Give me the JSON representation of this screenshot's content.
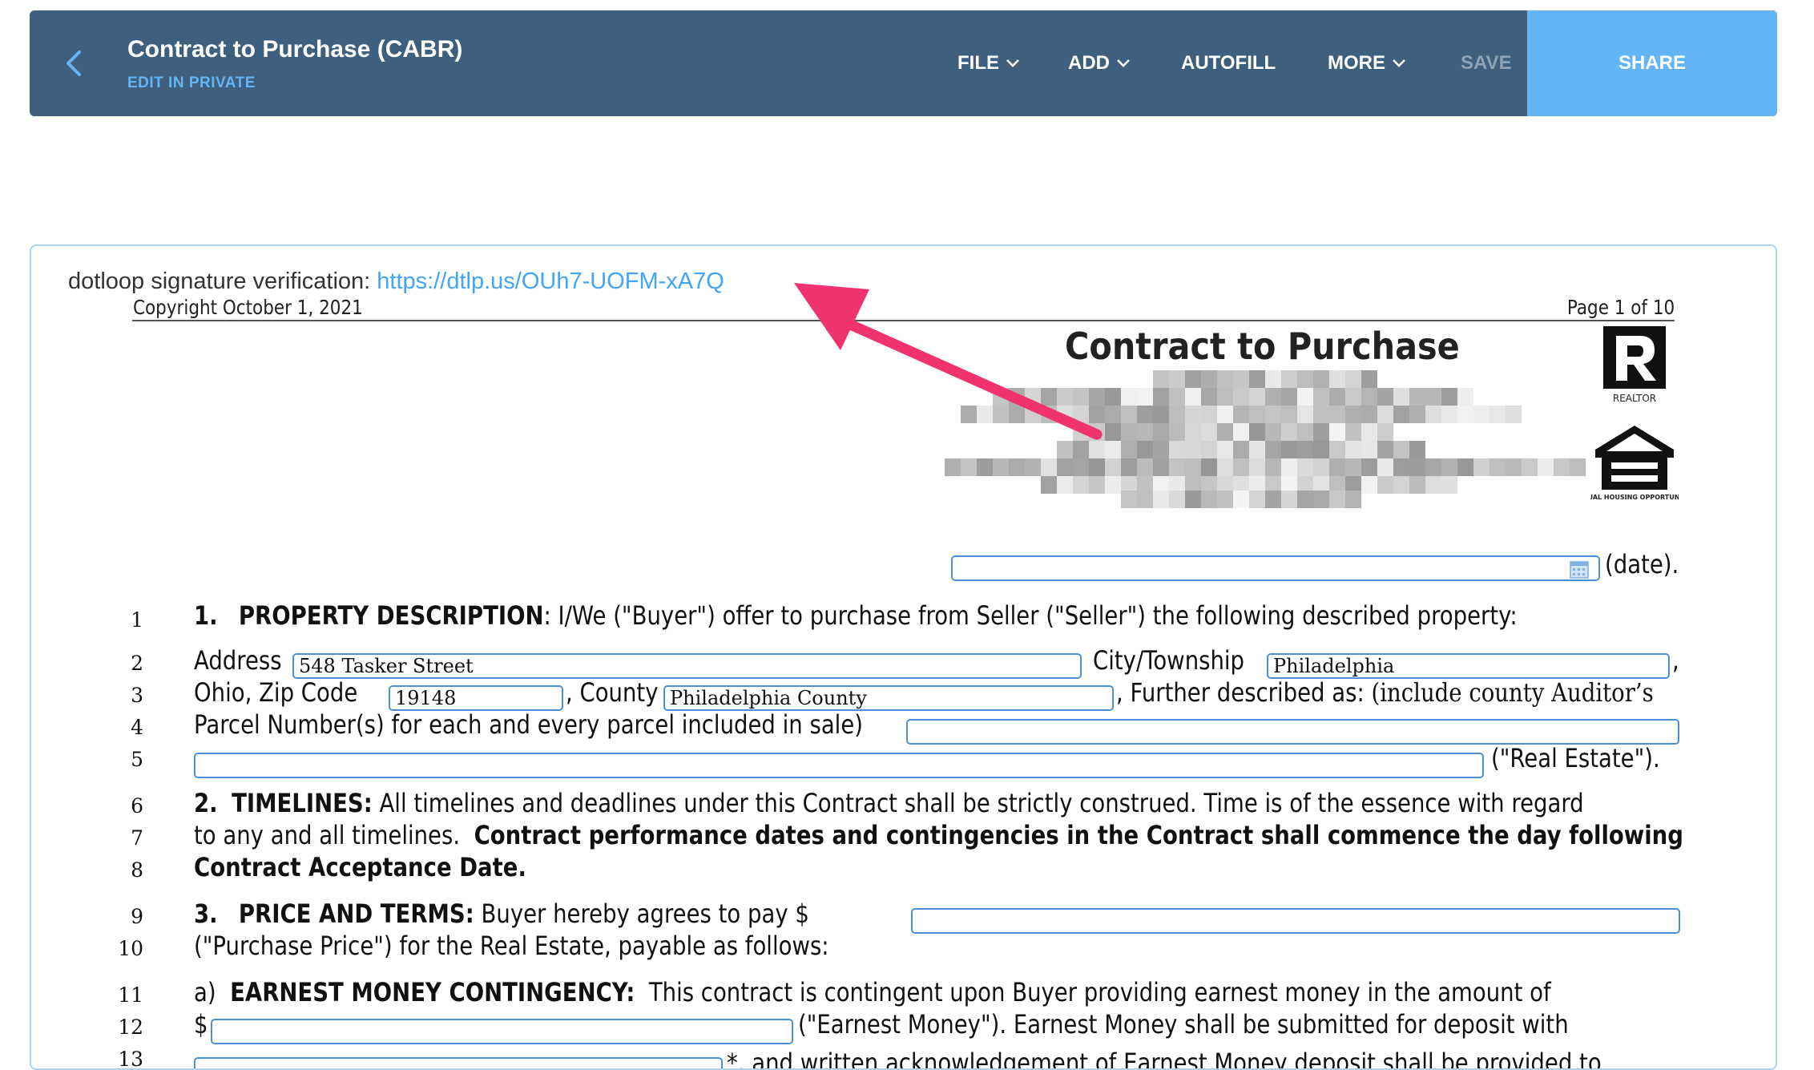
{
  "header": {
    "title": "Contract to Purchase (CABR)",
    "subtitle": "EDIT IN PRIVATE",
    "menu": {
      "file": "FILE",
      "add": "ADD",
      "autofill": "AUTOFILL",
      "more": "MORE",
      "save": "SAVE",
      "share": "SHARE"
    },
    "colors": {
      "bar": "#3e5f7d",
      "accent": "#64b5f6"
    },
    "icons": {
      "back": "chevron-left-icon",
      "dropdown": "chevron-down-icon"
    }
  },
  "verification": {
    "label": "dotloop signature verification:",
    "link": "https://dtlp.us/OUh7-UOFM-xA7Q"
  },
  "document": {
    "copyright": "Copyright October 1, 2021",
    "page": "Page 1 of 10",
    "title": "Contract to Purchase",
    "realtor_label": "REALTOR",
    "eho_label": "EQUAL HOUSING OPPORTUNITY",
    "date_suffix": "(date).",
    "fields": {
      "address": "548 Tasker Street",
      "city": "Philadelphia",
      "zip": "19148",
      "county": "Philadelphia County"
    },
    "lines": {
      "l1_num": "1.",
      "l1_head": "PROPERTY DESCRIPTION",
      "l1_text": ":  I/We (\"Buyer\") offer to purchase from Seller (\"Seller\") the following described property:",
      "l2_address": "Address",
      "l2_city": "City/Township",
      "l2_comma": ",",
      "l3_ohio": "Ohio,  Zip Code",
      "l3_county": ", County",
      "l3_further": ", Further described as:",
      "l3_include": "(include county Auditor’s",
      "l4_text": "Parcel Number(s) for each and every parcel included in sale)",
      "l5_text": "(\"Real Estate\").",
      "l6_num": "2.",
      "l6_head": "TIMELINES:",
      "l6_text": "All timelines and deadlines under this Contract shall be strictly construed.  Time is of the essence with regard",
      "l7_text": "to any and all timelines.",
      "l7_bold": "Contract performance dates and contingencies in the Contract shall commence the day following",
      "l8_bold": "Contract Acceptance Date.",
      "l9_num": "3.",
      "l9_head": "PRICE AND TERMS:",
      "l9_text": "Buyer hereby agrees to pay $",
      "l10_text": "(\"Purchase Price\") for the Real Estate, payable as follows:",
      "l11_num": "a)",
      "l11_head": "EARNEST MONEY CONTINGENCY:",
      "l11_text": "This contract is contingent upon Buyer providing earnest money in the amount of",
      "l12_dollar": "$",
      "l12_text": "(\"Earnest Money\").   Earnest Money shall be submitted for deposit with",
      "l13_text": "*, and written acknowledgement of Earnest Money deposit shall be provided to"
    },
    "line_numbers": [
      "1",
      "2",
      "3",
      "4",
      "5",
      "6",
      "7",
      "8",
      "9",
      "10",
      "11",
      "12",
      "13"
    ],
    "annotation_color": "#f0326e"
  }
}
